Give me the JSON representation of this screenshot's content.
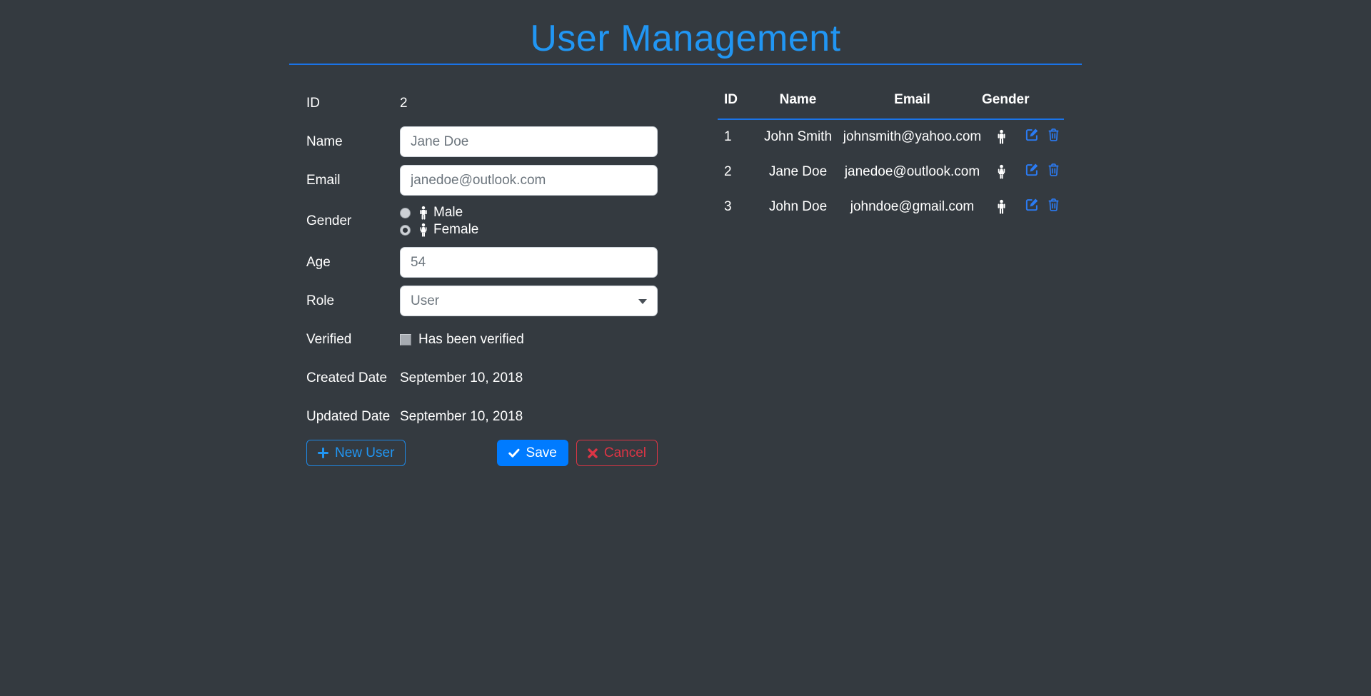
{
  "title": "User Management",
  "colors": {
    "background": "#343a40",
    "accent_blue": "#2196f3",
    "divider_blue": "#1a73e8",
    "primary_button": "#007bff",
    "danger": "#dc3545"
  },
  "form": {
    "fields": {
      "id": {
        "label": "ID",
        "value": "2"
      },
      "name": {
        "label": "Name",
        "value": "Jane Doe"
      },
      "email": {
        "label": "Email",
        "value": "janedoe@outlook.com"
      },
      "gender": {
        "label": "Gender",
        "options": [
          {
            "label": "Male",
            "selected": false
          },
          {
            "label": "Female",
            "selected": true
          }
        ]
      },
      "age": {
        "label": "Age",
        "value": "54"
      },
      "role": {
        "label": "Role",
        "value": "User"
      },
      "verified": {
        "label": "Verified",
        "checkbox_label": "Has been verified",
        "checked": false
      },
      "created": {
        "label": "Created Date",
        "value": "September 10, 2018"
      },
      "updated": {
        "label": "Updated Date",
        "value": "September 10, 2018"
      }
    },
    "buttons": {
      "new_user": "New User",
      "save": "Save",
      "cancel": "Cancel"
    }
  },
  "table": {
    "headers": {
      "id": "ID",
      "name": "Name",
      "email": "Email",
      "gender": "Gender"
    },
    "rows": [
      {
        "id": "1",
        "name": "John Smith",
        "email": "johnsmith@yahoo.com",
        "gender": "male"
      },
      {
        "id": "2",
        "name": "Jane Doe",
        "email": "janedoe@outlook.com",
        "gender": "female"
      },
      {
        "id": "3",
        "name": "John Doe",
        "email": "johndoe@gmail.com",
        "gender": "male"
      }
    ]
  }
}
